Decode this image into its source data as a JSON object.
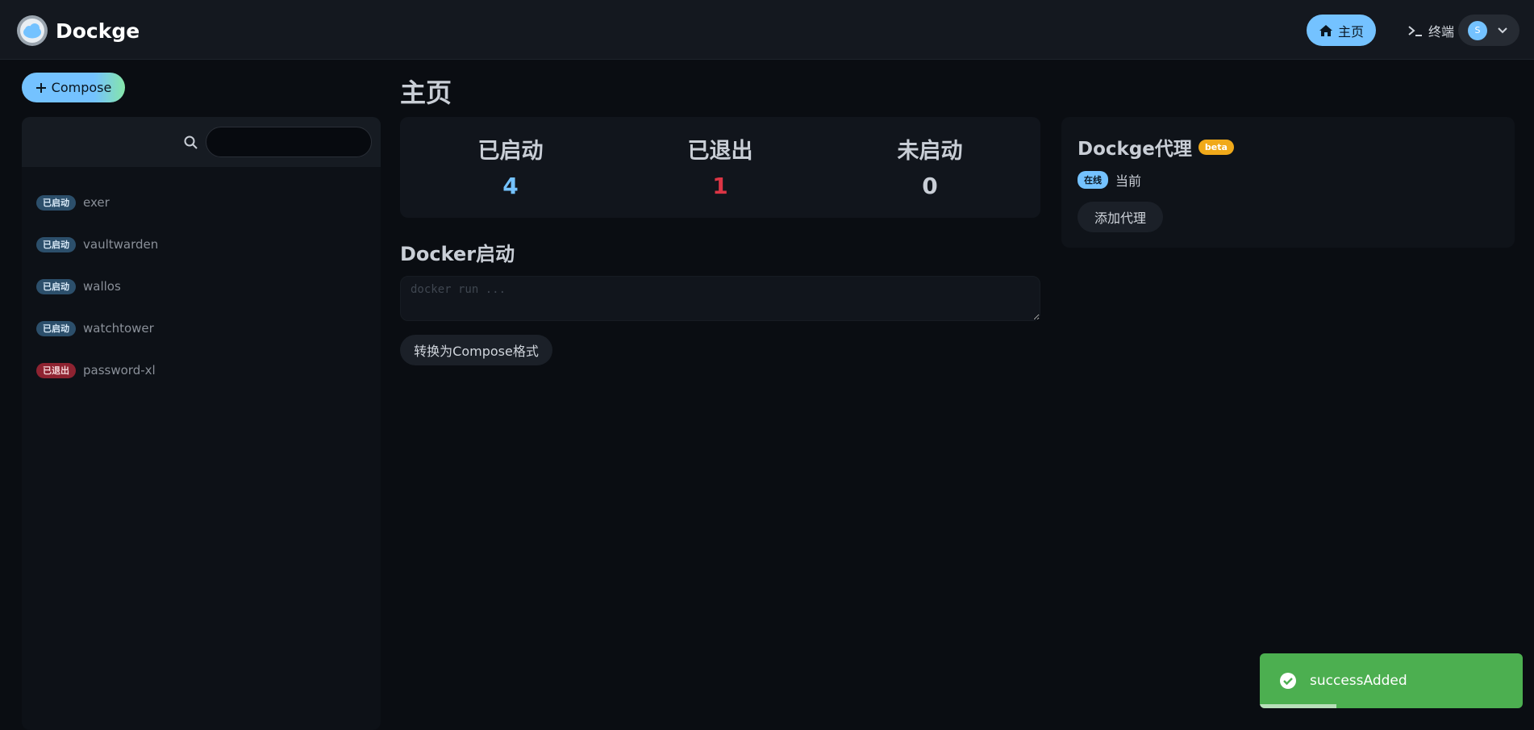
{
  "header": {
    "app_title": "Dockge",
    "nav_home": "主页",
    "nav_terminal": "终端",
    "user_avatar_initial": "S"
  },
  "sidebar": {
    "compose_button": "Compose",
    "search": {
      "value": "",
      "placeholder": ""
    },
    "stacks": [
      {
        "status": "已启动",
        "name": "exer",
        "state": "running"
      },
      {
        "status": "已启动",
        "name": "vaultwarden",
        "state": "running"
      },
      {
        "status": "已启动",
        "name": "wallos",
        "state": "running"
      },
      {
        "status": "已启动",
        "name": "watchtower",
        "state": "running"
      },
      {
        "status": "已退出",
        "name": "password-xl",
        "state": "exited"
      }
    ]
  },
  "main": {
    "page_title": "主页",
    "stats": [
      {
        "label": "已启动",
        "value": "4",
        "color": "#74c2ff"
      },
      {
        "label": "已退出",
        "value": "1",
        "color": "#dc3545"
      },
      {
        "label": "未启动",
        "value": "0",
        "color": "#c9ced6"
      }
    ],
    "docker_run": {
      "title": "Docker启动",
      "placeholder": "docker run ...",
      "convert_button": "转换为Compose格式"
    }
  },
  "agent": {
    "title": "Dockge代理",
    "beta": "beta",
    "online_badge": "在线",
    "current": "当前",
    "add_button": "添加代理"
  },
  "toast": {
    "message": "successAdded",
    "progress": 0.29
  },
  "colors": {
    "accent": "#74c2ff",
    "danger": "#dc3545",
    "success": "#4caf50",
    "warning": "#f0a91a"
  }
}
